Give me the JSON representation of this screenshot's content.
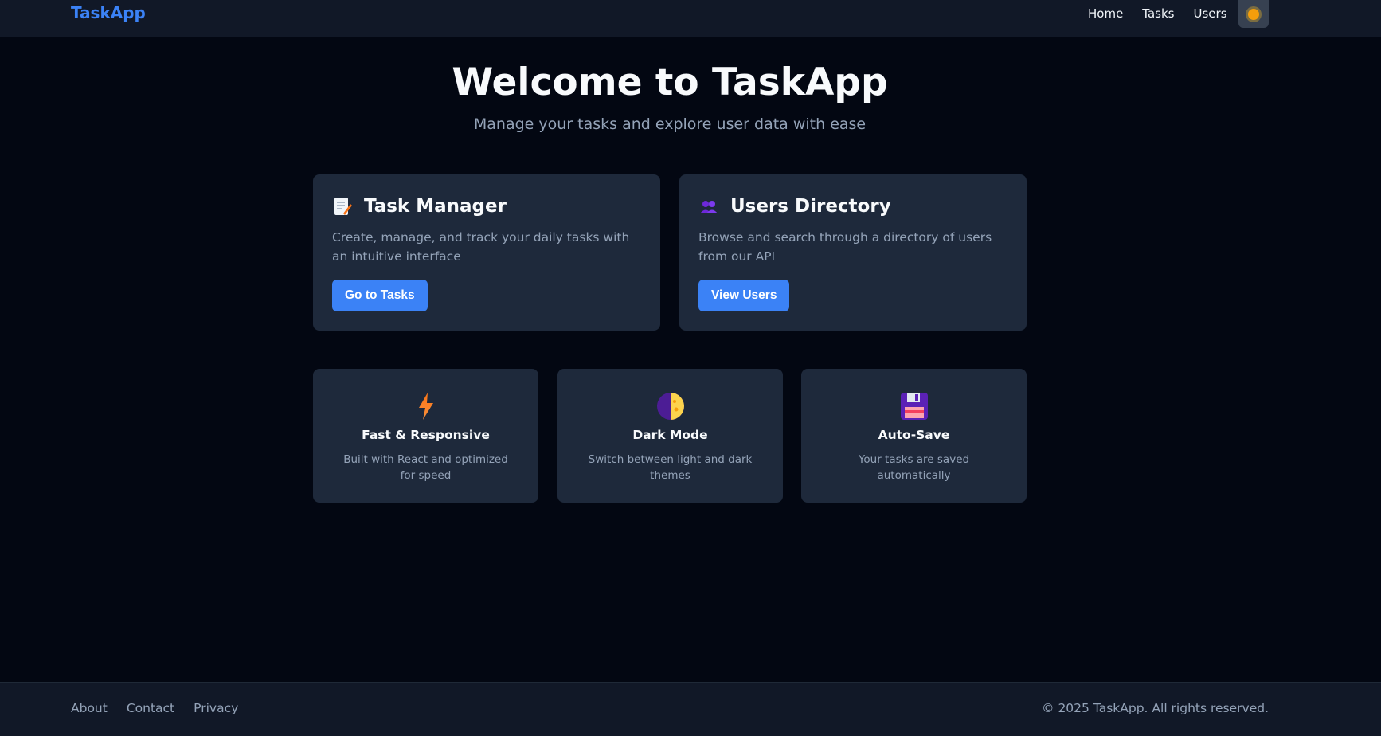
{
  "nav": {
    "brand": "TaskApp",
    "links": [
      "Home",
      "Tasks",
      "Users"
    ],
    "theme_toggle_icon": "sun-icon"
  },
  "hero": {
    "title": "Welcome to TaskApp",
    "subtitle": "Manage your tasks and explore user data with ease"
  },
  "cards": [
    {
      "icon": "memo-icon",
      "title": "Task Manager",
      "description": "Create, manage, and track your daily tasks with an intuitive interface",
      "button": "Go to Tasks"
    },
    {
      "icon": "users-icon",
      "title": "Users Directory",
      "description": "Browse and search through a directory of users from our API",
      "button": "View Users"
    }
  ],
  "features": [
    {
      "icon": "lightning-icon",
      "title": "Fast & Responsive",
      "description": "Built with React and optimized for speed"
    },
    {
      "icon": "moon-icon",
      "title": "Dark Mode",
      "description": "Switch between light and dark themes"
    },
    {
      "icon": "floppy-disk-icon",
      "title": "Auto-Save",
      "description": "Your tasks are saved automatically"
    }
  ],
  "footer": {
    "links": [
      "About",
      "Contact",
      "Privacy"
    ],
    "copyright": "© 2025 TaskApp. All rights reserved."
  },
  "colors": {
    "accent": "#3b82f6",
    "background": "#030712",
    "surface": "#1e293b",
    "navbar": "#111827"
  }
}
